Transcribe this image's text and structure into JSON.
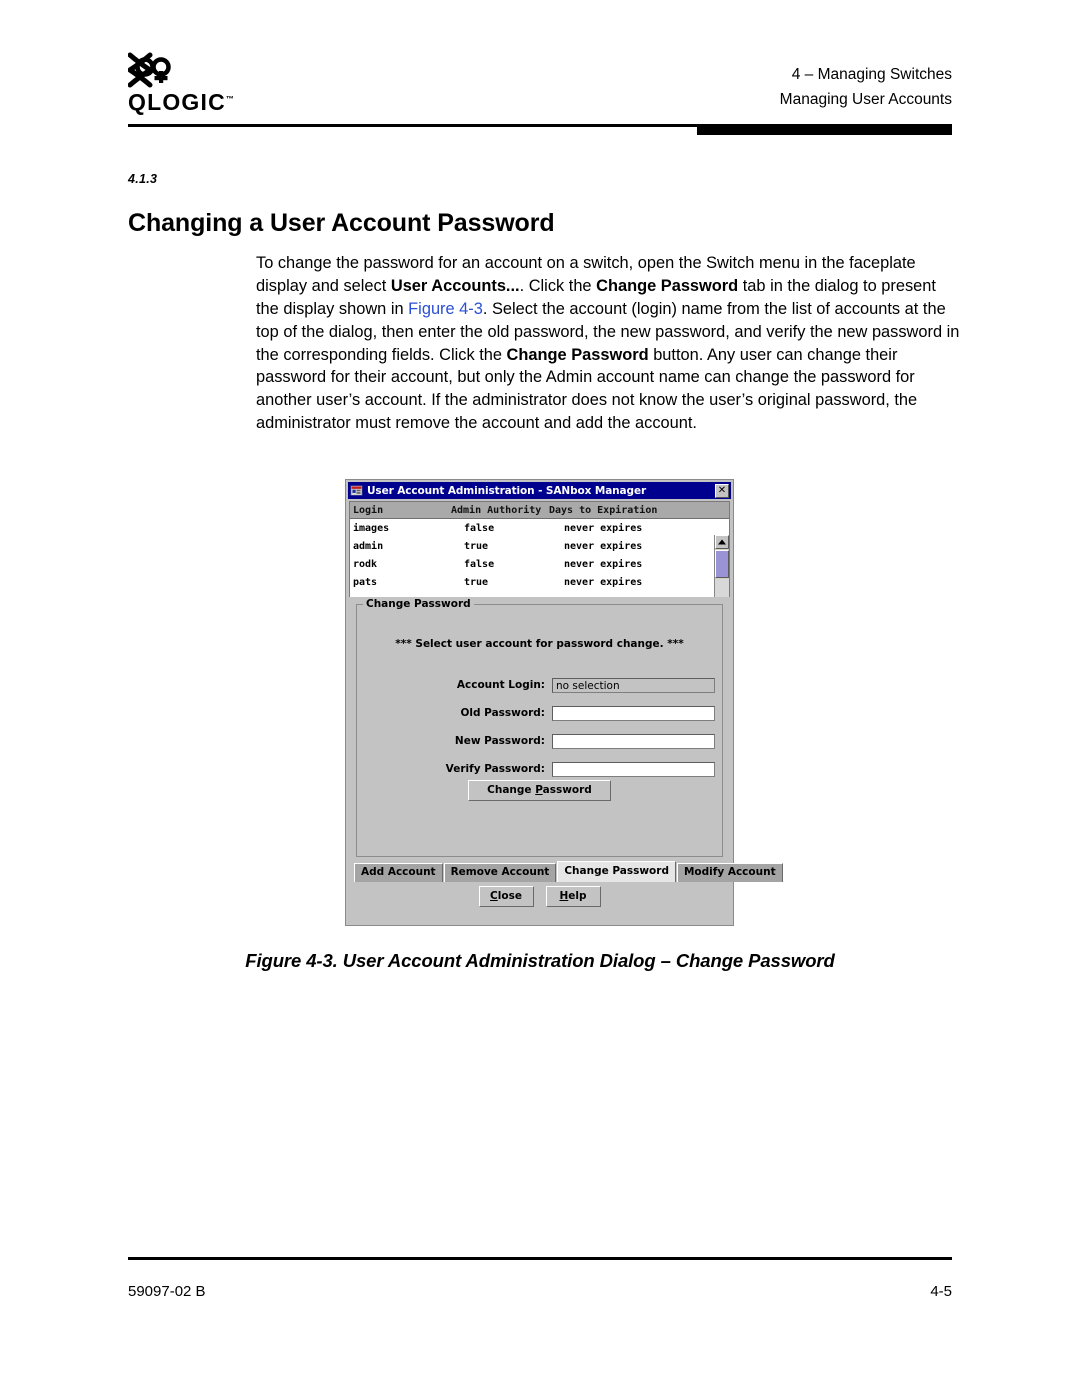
{
  "page": {
    "header": {
      "logo_word": "QLOGIC",
      "logo_tm": "™",
      "chapter_line": "4 – Managing Switches",
      "section_line": "Managing User Accounts"
    },
    "section": {
      "number": "4.1.3",
      "title": "Changing a User Account Password"
    },
    "body": {
      "p1_a": "To change the password for an account on a switch, open the Switch menu in the faceplate display and select ",
      "p1_b_user_accounts": "User Accounts...",
      "p1_c": ". Click the ",
      "p1_d_change_password": "Change Password",
      "p1_e": " tab in the dialog to present the display shown in ",
      "p1_f_xref": "Figure 4-3",
      "p1_g": ". Select the account (login) name from the list of accounts at the top of the dialog, then enter the old password, the new password, and verify the new password in the corresponding fields. Click the ",
      "p1_h_change_password": "Change Password",
      "p1_i": " button. Any user can change their password for their account, but only the Admin account name can change the password for another user’s account. If the administrator does not know the user’s original password, the administrator must remove the account and add the account."
    },
    "figure_caption": "Figure 4-3.  User Account Administration Dialog – Change Password",
    "footer": {
      "doc_number": "59097-02 B",
      "page_number": "4-5"
    }
  },
  "dialog": {
    "titlebar": {
      "icon": "app-window-icon",
      "title": "User Account Administration - SANbox Manager",
      "close_label": "✕"
    },
    "accounts_table": {
      "columns": [
        "Login",
        "Admin Authority",
        "Days to Expiration"
      ],
      "rows": [
        {
          "login": "images",
          "admin_authority": "false",
          "days_to_expiration": "never expires"
        },
        {
          "login": "admin",
          "admin_authority": "true",
          "days_to_expiration": "never expires"
        },
        {
          "login": "rodk",
          "admin_authority": "false",
          "days_to_expiration": "never expires"
        },
        {
          "login": "pats",
          "admin_authority": "true",
          "days_to_expiration": "never expires"
        }
      ]
    },
    "scrollbar": {
      "up_icon": "scroll-up-arrow-icon",
      "down_icon": "scroll-down-arrow-icon",
      "thumb_color": "#9a93d6"
    },
    "panel": {
      "legend": "Change Password",
      "hint": "*** Select user account for password change. ***",
      "fields": [
        {
          "label": "Account Login:",
          "value": "no selection",
          "readonly": true
        },
        {
          "label": "Old Password:",
          "value": "",
          "readonly": false
        },
        {
          "label": "New Password:",
          "value": "",
          "readonly": false
        },
        {
          "label": "Verify Password:",
          "value": "",
          "readonly": false
        }
      ],
      "submit": {
        "pre": "Change ",
        "mnemonic": "P",
        "post": "assword"
      }
    },
    "tabs": [
      {
        "label": "Add Account",
        "active": false
      },
      {
        "label": "Remove Account",
        "active": false
      },
      {
        "label": "Change Password",
        "active": true
      },
      {
        "label": "Modify Account",
        "active": false
      }
    ],
    "bottom_buttons": [
      {
        "mnemonic": "C",
        "post": "lose"
      },
      {
        "mnemonic": "H",
        "post": "elp"
      }
    ]
  }
}
